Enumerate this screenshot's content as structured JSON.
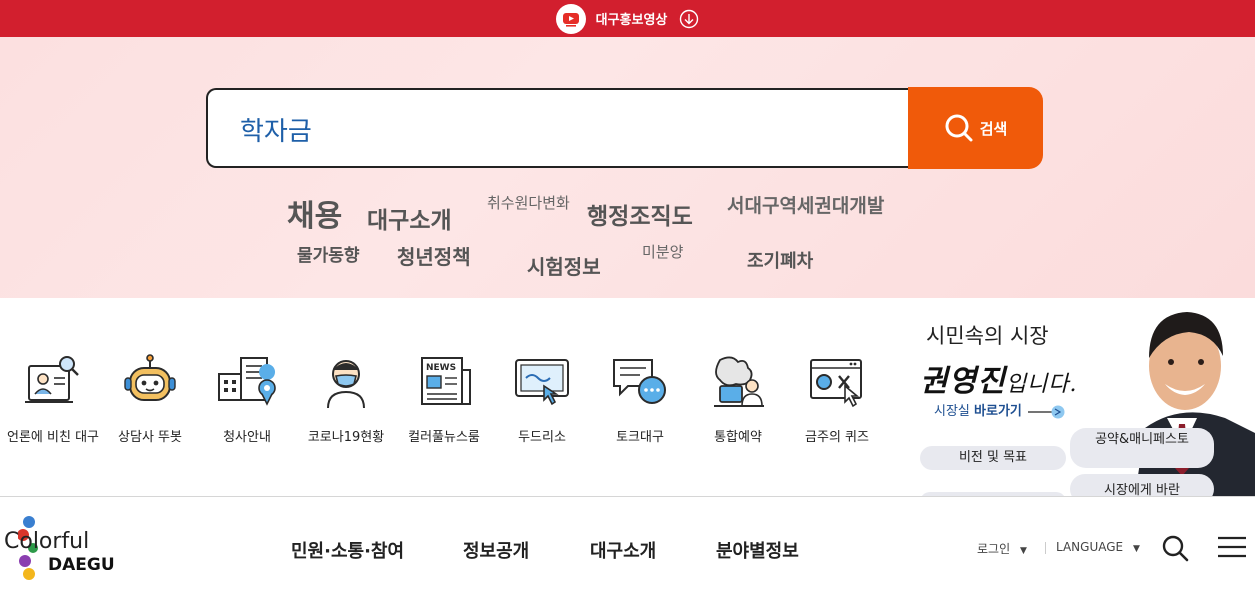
{
  "topbar": {
    "label": "대구홍보영상"
  },
  "search": {
    "value": "학자금",
    "button_label": "검색"
  },
  "keywords": [
    "채용",
    "대구소개",
    "취수원다변화",
    "행정조직도",
    "서대구역세권대개발",
    "물가동향",
    "청년정책",
    "시험정보",
    "미분양",
    "조기폐차"
  ],
  "services": [
    "언론에 비친 대구",
    "상담사 뚜봇",
    "청사안내",
    "코로나19현황",
    "컬러풀뉴스룸",
    "두드리소",
    "토크대구",
    "통합예약",
    "금주의 퀴즈"
  ],
  "mayor": {
    "headline": "시민속의 시장",
    "name": "권영진",
    "suffix": "입니다.",
    "link_prefix": "시장실",
    "link_label": "바로가기",
    "pills": [
      "비전 및 목표",
      "공약&매니페스토",
      "시장에게 바란"
    ]
  },
  "logo": {
    "line1": "Colorful",
    "line2": "DAEGU"
  },
  "nav": [
    "민원·소통·참여",
    "정보공개",
    "대구소개",
    "분야별정보"
  ],
  "util": {
    "login": "로그인",
    "language": "LANGUAGE"
  },
  "colors": {
    "topbar": "#d21f2e",
    "search_button": "#f05a0a",
    "hero_bg": "#fde4e4"
  }
}
